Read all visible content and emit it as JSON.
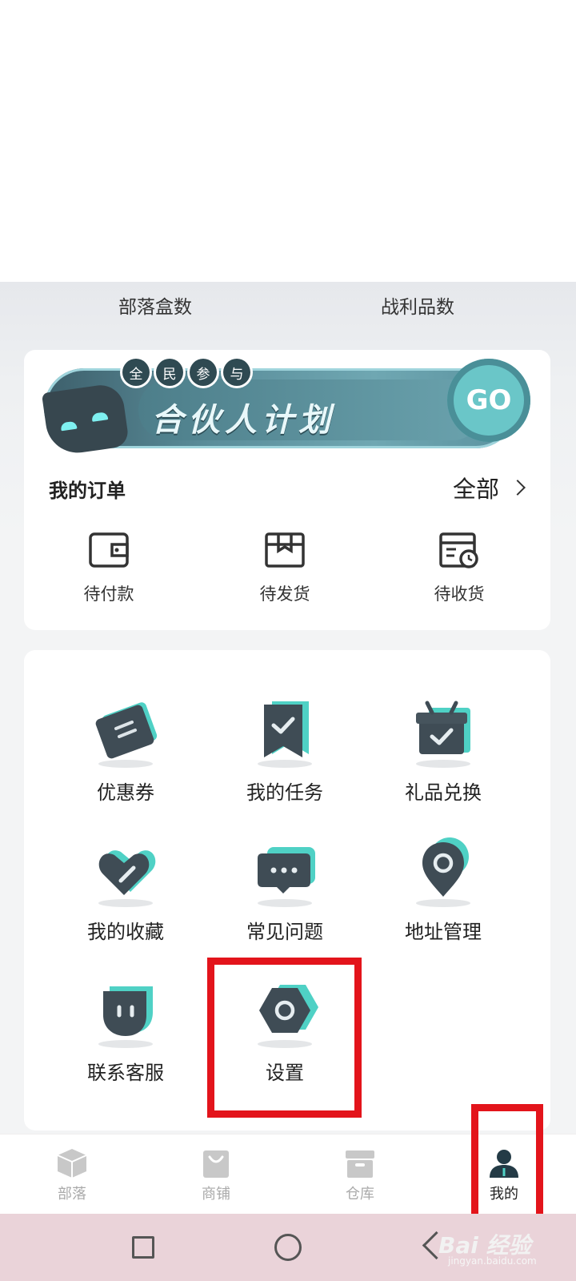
{
  "stats": {
    "tribe_boxes_label": "部落盒数",
    "loot_count_label": "战利品数"
  },
  "banner": {
    "tags": [
      "全",
      "民",
      "参",
      "与"
    ],
    "title": "合伙人计划",
    "go_label": "GO"
  },
  "orders": {
    "title": "我的订单",
    "all_label": "全部",
    "items": [
      {
        "label": "待付款",
        "icon": "wallet-icon"
      },
      {
        "label": "待发货",
        "icon": "box-icon"
      },
      {
        "label": "待收货",
        "icon": "receipt-clock-icon"
      }
    ]
  },
  "menu": {
    "items": [
      {
        "label": "优惠券",
        "icon": "coupon-icon"
      },
      {
        "label": "我的任务",
        "icon": "task-ribbon-icon"
      },
      {
        "label": "礼品兑换",
        "icon": "gift-icon"
      },
      {
        "label": "我的收藏",
        "icon": "heart-icon"
      },
      {
        "label": "常见问题",
        "icon": "chat-bubble-icon"
      },
      {
        "label": "地址管理",
        "icon": "location-pin-icon"
      },
      {
        "label": "联系客服",
        "icon": "customer-service-icon"
      },
      {
        "label": "设置",
        "icon": "settings-hexagon-icon"
      }
    ]
  },
  "tabbar": {
    "items": [
      {
        "label": "部落",
        "icon": "cube-icon",
        "active": false
      },
      {
        "label": "商铺",
        "icon": "shopping-bag-icon",
        "active": false
      },
      {
        "label": "仓库",
        "icon": "storage-box-icon",
        "active": false
      },
      {
        "label": "我的",
        "icon": "user-icon",
        "active": true
      }
    ]
  },
  "watermark": {
    "text": "Bai 经验",
    "sub": "jingyan.baidu.com"
  },
  "colors": {
    "accent_teal": "#4fd1c5",
    "icon_dark": "#3c4a52",
    "highlight_red": "#e3141b"
  }
}
